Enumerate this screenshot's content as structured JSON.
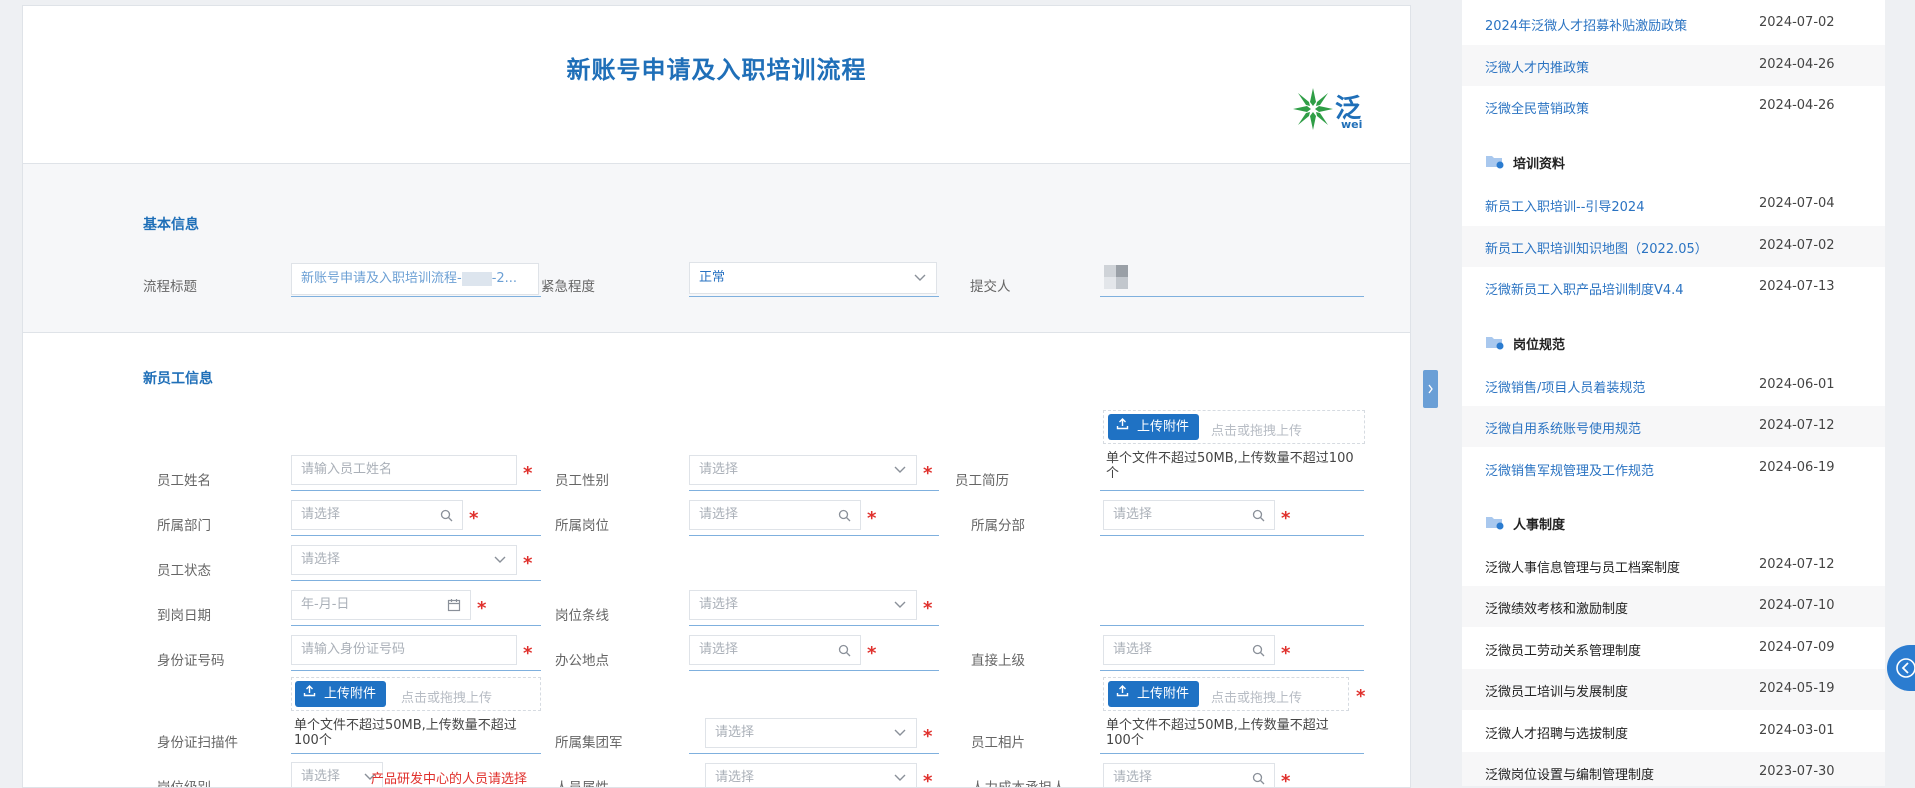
{
  "form": {
    "title": "新账号申请及入职培训流程",
    "logo_text": "泛",
    "logo_subtext": "wei",
    "basic": {
      "section_title": "基本信息",
      "flow_title_label": "流程标题",
      "flow_title_value": "新账号申请及入职培训流程-",
      "flow_title_suffix": "-2...",
      "urgency_label": "紧急程度",
      "urgency_value": "正常",
      "submitter_label": "提交人"
    },
    "employee": {
      "section_title": "新员工信息",
      "name_label": "员工姓名",
      "name_placeholder": "请输入员工姓名",
      "gender_label": "员工性别",
      "resume_label": "员工简历",
      "dept_label": "所属部门",
      "position_label": "所属岗位",
      "branch_label": "所属分部",
      "status_label": "员工状态",
      "arrival_label": "到岗日期",
      "date_placeholder": "年-月-日",
      "post_line_label": "岗位条线",
      "id_label": "身份证号码",
      "id_placeholder": "请输入身份证号码",
      "office_label": "办公地点",
      "supervisor_label": "直接上级",
      "id_scan_label": "身份证扫描件",
      "group_label": "所属集团军",
      "photo_label": "员工相片",
      "level_label": "岗位级别",
      "level_note": "产品研发中心的人员请选择",
      "attr_label": "人员属性",
      "cost_label": "人力成本承担人",
      "select_placeholder": "请选择",
      "upload_label": "上传附件",
      "drop_text": "点击或拖拽上传",
      "upload_hint_1": "单个文件不超过50MB,上传数量不超过100",
      "upload_hint_2": "个",
      "upload_hint_a": "单个文件不超过50MB,上传数量不超过",
      "upload_hint_b": "100个"
    }
  },
  "sidebar": {
    "top_items": [
      {
        "label": "2024年泛微人才招募补贴激励政策",
        "date": "2024-07-02"
      },
      {
        "label": "泛微人才内推政策",
        "date": "2024-04-26"
      },
      {
        "label": "泛微全民营销政策",
        "date": "2024-04-26"
      }
    ],
    "training_title": "培训资料",
    "training_items": [
      {
        "label": "新员工入职培训--引导2024",
        "date": "2024-07-04"
      },
      {
        "label": "新员工入职培训知识地图（2022.05）",
        "date": "2024-07-02"
      },
      {
        "label": "泛微新员工入职产品培训制度V4.4",
        "date": "2024-07-13"
      }
    ],
    "post_title": "岗位规范",
    "post_items": [
      {
        "label": "泛微销售/项目人员着装规范",
        "date": "2024-06-01"
      },
      {
        "label": "泛微自用系统账号使用规范",
        "date": "2024-07-12"
      },
      {
        "label": "泛微销售军规管理及工作规范",
        "date": "2024-06-19"
      }
    ],
    "hr_title": "人事制度",
    "hr_items": [
      {
        "label": "泛微人事信息管理与员工档案制度",
        "date": "2024-07-12"
      },
      {
        "label": "泛微绩效考核和激励制度",
        "date": "2024-07-10"
      },
      {
        "label": "泛微员工劳动关系管理制度",
        "date": "2024-07-09"
      },
      {
        "label": "泛微员工培训与发展制度",
        "date": "2024-05-19"
      },
      {
        "label": "泛微人才招聘与选拔制度",
        "date": "2024-03-01"
      },
      {
        "label": "泛微岗位设置与编制管理制度",
        "date": "2023-07-30"
      }
    ]
  },
  "colors": {
    "accent": "#1f6fb8",
    "required": "#e0312d",
    "upload": "#1f72c4"
  }
}
